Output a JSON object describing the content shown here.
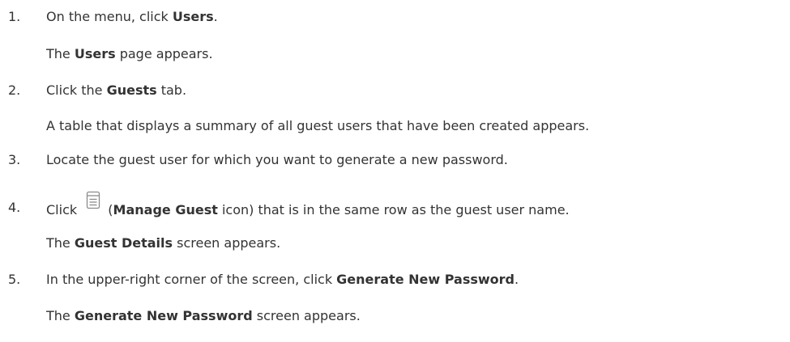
{
  "steps": [
    {
      "number": "1.",
      "text_before": "On the menu, click ",
      "bold": "Users",
      "text_after": ".",
      "result_before": "The ",
      "result_bold": "Users",
      "result_after": " page appears."
    },
    {
      "number": "2.",
      "text_before": "Click the ",
      "bold": "Guests",
      "text_after": " tab.",
      "result": "A table that displays a summary of all guest users that have been created appears."
    },
    {
      "number": "3.",
      "text": "Locate the guest user for which you want to generate a new password."
    },
    {
      "number": "4.",
      "text_before": "Click ",
      "icon": "manage-guest-icon",
      "text_paren_open": " (",
      "bold": "Manage Guest",
      "text_after": " icon) that is in the same row as the guest user name.",
      "result_before": "The ",
      "result_bold": "Guest Details",
      "result_after": " screen appears."
    },
    {
      "number": "5.",
      "text_before": "In the upper-right corner of the screen, click ",
      "bold": "Generate New Password",
      "text_after": ".",
      "result_before": "The ",
      "result_bold": "Generate New Password",
      "result_after": " screen appears."
    }
  ],
  "colors": {
    "text": "#333333",
    "icon_stroke": "#8a8a8a"
  }
}
